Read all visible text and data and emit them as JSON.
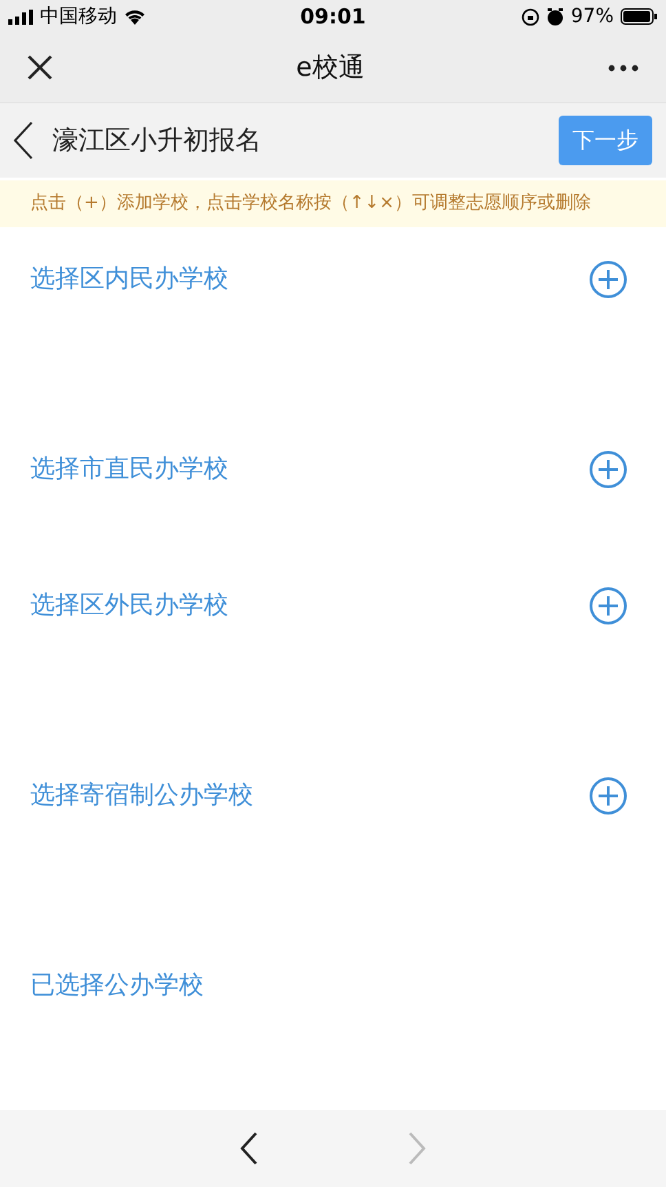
{
  "status_bar": {
    "carrier": "中国移动",
    "time": "09:01",
    "battery": "97%"
  },
  "nav_bar": {
    "title": "e校通"
  },
  "header": {
    "title": "濠江区小升初报名",
    "next_button": "下一步"
  },
  "notice": "点击（+）添加学校，点击学校名称按（↑↓×）可调整志愿顺序或删除",
  "sections": [
    {
      "label": "选择区内民办学校",
      "kind": "picker"
    },
    {
      "label": "选择市直民办学校",
      "kind": "picker"
    },
    {
      "label": "选择区外民办学校",
      "kind": "picker"
    },
    {
      "label": "选择寄宿制公办学校",
      "kind": "picker"
    },
    {
      "label": "已选择公办学校",
      "kind": "summary"
    }
  ],
  "toolbar": {
    "back_disabled": false,
    "forward_disabled": true
  }
}
